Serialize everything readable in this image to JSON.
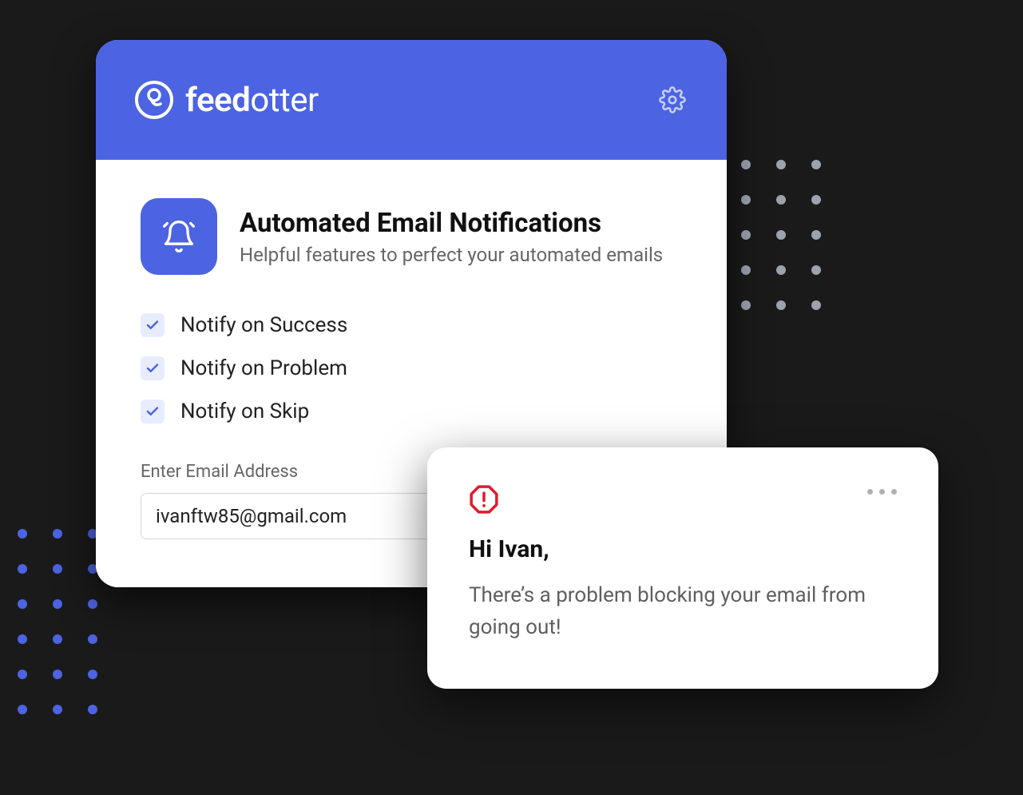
{
  "colors": {
    "brand": "#4c63e2",
    "alert": "#e11a2b"
  },
  "header": {
    "brand_prefix": "feed",
    "brand_suffix": "otter",
    "settings_icon": "gear-icon"
  },
  "section": {
    "icon": "bell-icon",
    "title": "Automated Email Notifications",
    "subtitle": "Helpful features to perfect your automated emails"
  },
  "checkboxes": [
    {
      "label": "Notify on Success",
      "checked": true
    },
    {
      "label": "Notify on Problem",
      "checked": true
    },
    {
      "label": "Notify on Skip",
      "checked": true
    }
  ],
  "email_field": {
    "label": "Enter Email Address",
    "value": "ivanftw85@gmail.com"
  },
  "notification": {
    "icon": "alert-octagon-icon",
    "greeting": "Hi Ivan,",
    "message": "There’s a problem blocking your email from going out!"
  }
}
